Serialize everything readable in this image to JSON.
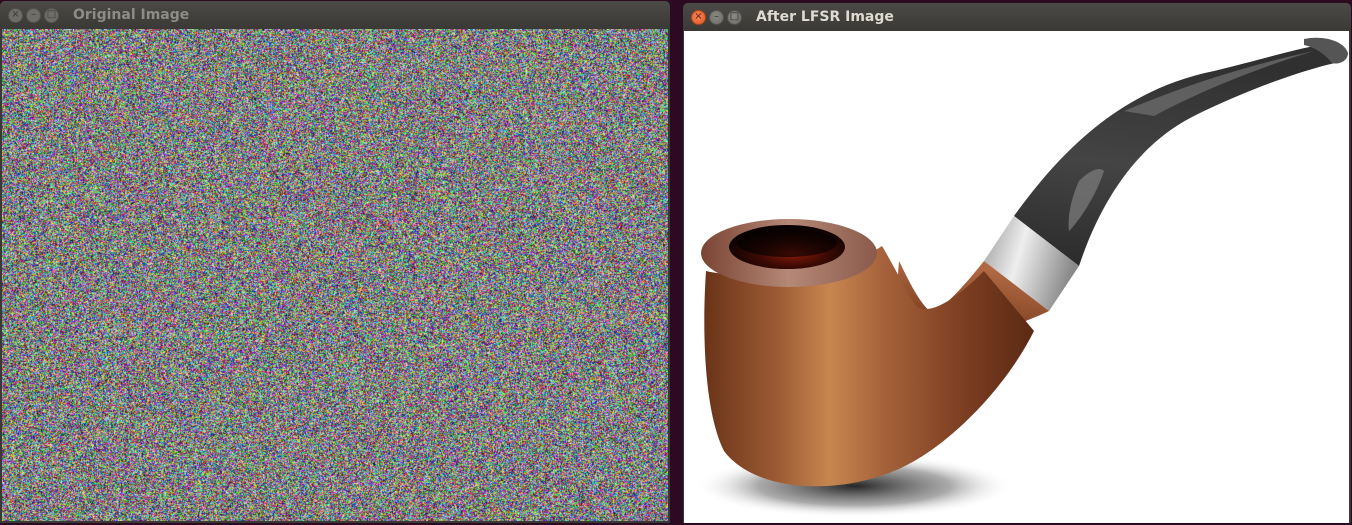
{
  "windows": {
    "left": {
      "title": "Original Image",
      "buttons": {
        "close": "×",
        "minimize": "–",
        "maximize": "□"
      }
    },
    "right": {
      "title": "After LFSR Image",
      "buttons": {
        "close": "×",
        "minimize": "–",
        "maximize": "□"
      }
    }
  },
  "images": {
    "left": {
      "content": "random color noise"
    },
    "right": {
      "content": "tobacco pipe"
    }
  },
  "colors": {
    "desktop": "#2c0a22",
    "titlebar": "#3c3b37",
    "close_active": "#e95420",
    "pipe_bowl": "#a05a35",
    "pipe_stem": "#3a3a3a",
    "pipe_band": "#c8c8c8"
  }
}
